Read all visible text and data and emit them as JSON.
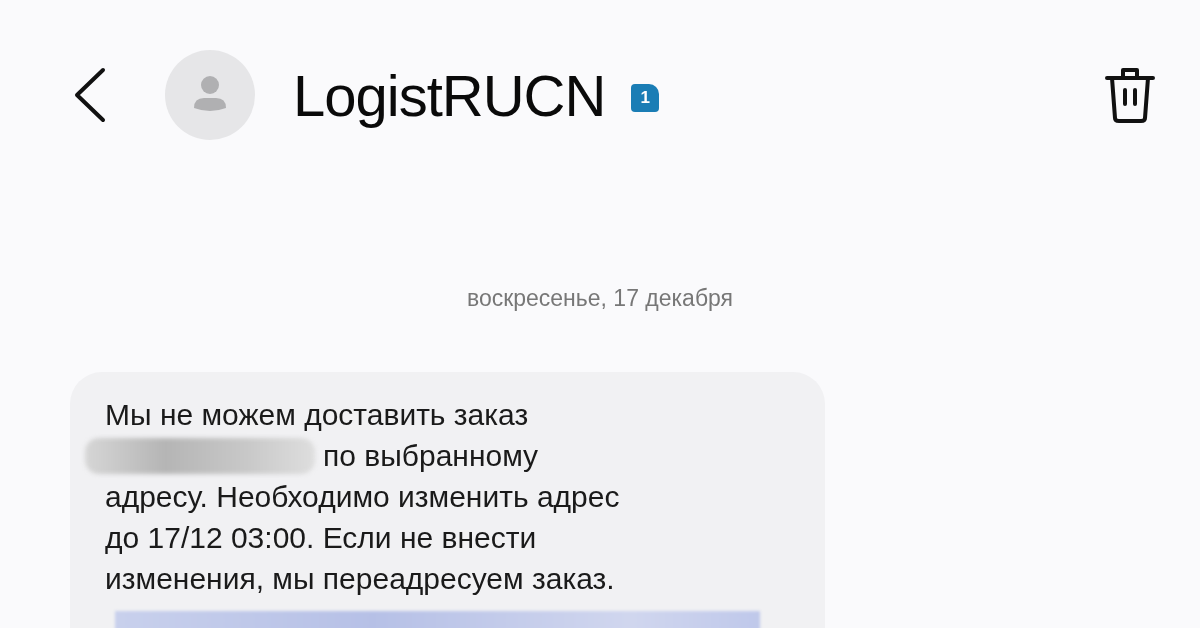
{
  "header": {
    "title": "LogistRUCN",
    "sim_badge": "1"
  },
  "date_divider": "воскресенье, 17 декабря",
  "message": {
    "lines": [
      {
        "text": "Мы не можем доставить заказ",
        "redacted_before": false
      },
      {
        "text": "по выбранному",
        "redacted_before": true
      },
      {
        "text": "адресу. Необходимо изменить адрес",
        "redacted_before": false
      },
      {
        "text": "до 17/12 03:00. Если не внести",
        "redacted_before": false
      },
      {
        "text": "изменения, мы переадресуем заказ.",
        "redacted_before": false
      }
    ],
    "link_redacted": true
  }
}
